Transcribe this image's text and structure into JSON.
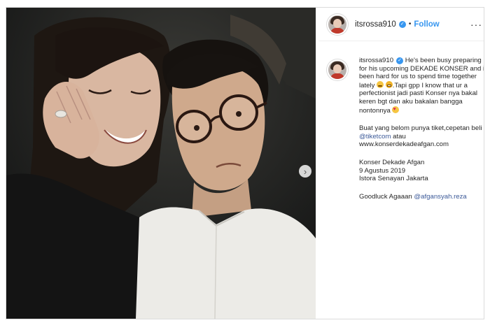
{
  "post": {
    "username": "itsrossa910",
    "follow_label": "Follow",
    "dot": "•",
    "more_label": "···",
    "next_label": "›"
  },
  "caption": {
    "username": "itsrossa910",
    "p1a": "He's been busy preparing for his upcoming DEKADE KONSER and its been hard for us to spend time together lately ",
    "p1b": ".Tapi gpp I know that ur a perfectionist jadi pasti Konser nya bakal keren bgt dan aku bakalan bangga nontonnya ",
    "p2a": "Buat yang belom punya tiket,cepetan beli di ",
    "p2_mention": "@tiketcom",
    "p2b": " atau",
    "p2_url": "www.konserdekadeafgan.com",
    "p3_line1": "Konser Dekade Afgan",
    "p3_line2": "9 Agustus 2019",
    "p3_line3": "Istora Senayan Jakarta",
    "p4a": "Goodluck Agaaan ",
    "p4_mention": "@afgansyah.reza",
    "emojis": [
      "flushed-face",
      "grimacing-face",
      "heart-eyes-face"
    ]
  },
  "colors": {
    "link_blue": "#3897f0",
    "mention_color": "#3b5998",
    "verified_badge": "#3897f0"
  }
}
